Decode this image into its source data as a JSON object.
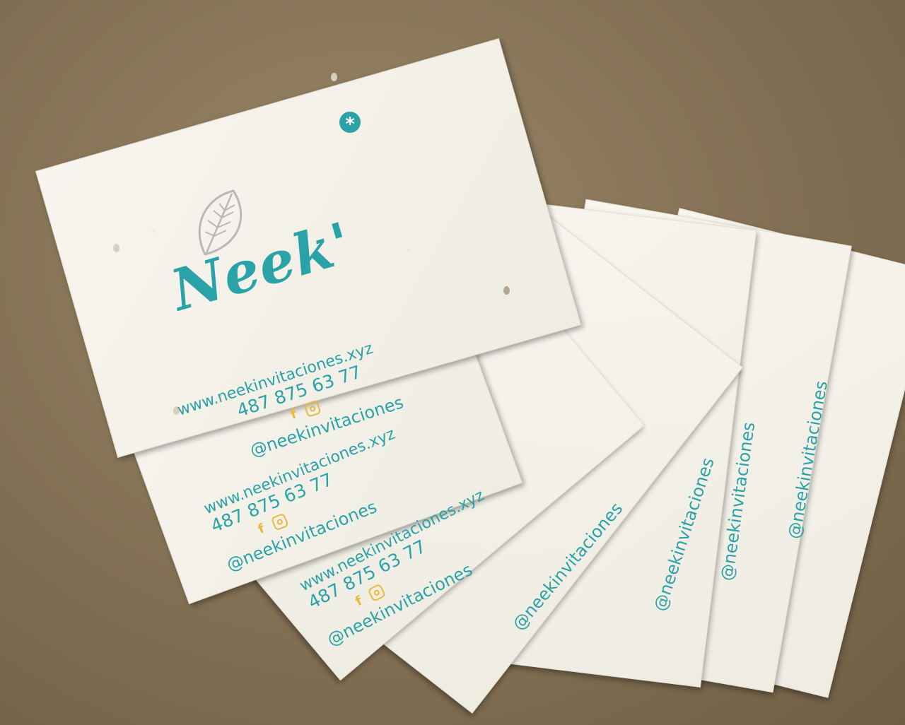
{
  "card": {
    "brand": "Neek'",
    "url": "www.neekinvitaciones.xyz",
    "phone": "487 875 63 77",
    "handle": "@neekinvitaciones",
    "icons": [
      "leaf-icon",
      "asterisk-icon",
      "facebook-icon",
      "instagram-icon"
    ]
  },
  "colors": {
    "teal": "#2aa3a8",
    "yellow": "#e8b93a",
    "paper": "#f4f1e8",
    "background": "#877457"
  }
}
